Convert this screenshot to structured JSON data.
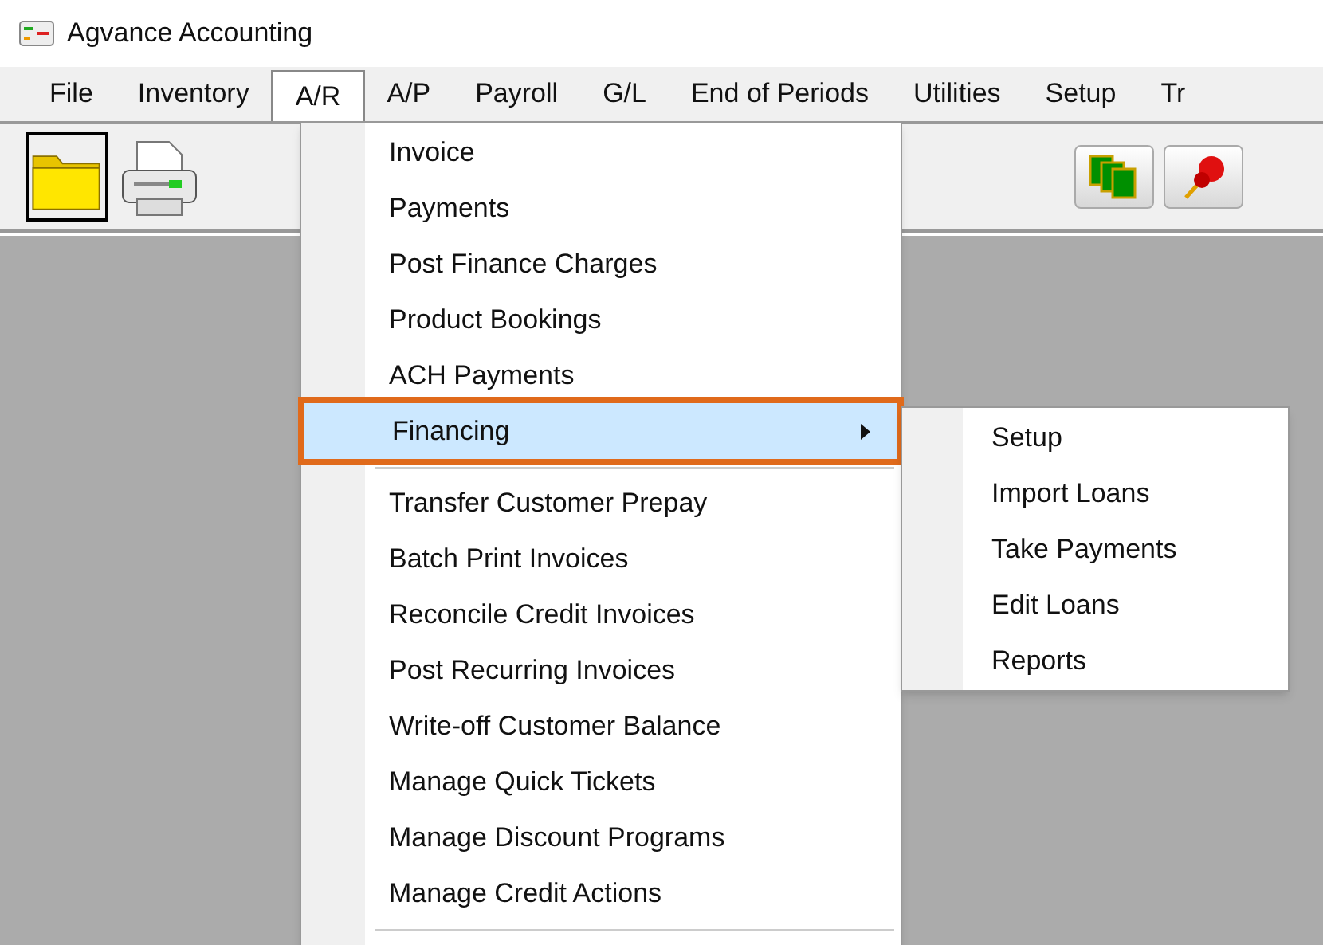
{
  "window": {
    "title": "Agvance Accounting"
  },
  "menu_bar": [
    {
      "label": "File",
      "selected": false
    },
    {
      "label": "Inventory",
      "selected": false
    },
    {
      "label": "A/R",
      "selected": true
    },
    {
      "label": "A/P",
      "selected": false
    },
    {
      "label": "Payroll",
      "selected": false
    },
    {
      "label": "G/L",
      "selected": false
    },
    {
      "label": "End of Periods",
      "selected": false
    },
    {
      "label": "Utilities",
      "selected": false
    },
    {
      "label": "Setup",
      "selected": false
    },
    {
      "label": "Tr",
      "selected": false
    }
  ],
  "dropdown": [
    {
      "kind": "item",
      "label": "Invoice",
      "selected": false,
      "submenu": false
    },
    {
      "kind": "item",
      "label": "Payments",
      "selected": false,
      "submenu": false
    },
    {
      "kind": "item",
      "label": "Post Finance Charges",
      "selected": false,
      "submenu": false
    },
    {
      "kind": "item",
      "label": "Product Bookings",
      "selected": false,
      "submenu": false
    },
    {
      "kind": "item",
      "label": "ACH Payments",
      "selected": false,
      "submenu": false
    },
    {
      "kind": "item",
      "label": "Financing",
      "selected": true,
      "submenu": true
    },
    {
      "kind": "separator"
    },
    {
      "kind": "item",
      "label": "Transfer Customer Prepay",
      "selected": false,
      "submenu": false
    },
    {
      "kind": "item",
      "label": "Batch Print Invoices",
      "selected": false,
      "submenu": false
    },
    {
      "kind": "item",
      "label": "Reconcile Credit Invoices",
      "selected": false,
      "submenu": false
    },
    {
      "kind": "item",
      "label": "Post Recurring Invoices",
      "selected": false,
      "submenu": false
    },
    {
      "kind": "item",
      "label": "Write-off Customer Balance",
      "selected": false,
      "submenu": false
    },
    {
      "kind": "item",
      "label": "Manage Quick Tickets",
      "selected": false,
      "submenu": false
    },
    {
      "kind": "item",
      "label": "Manage Discount Programs",
      "selected": false,
      "submenu": false
    },
    {
      "kind": "item",
      "label": "Manage Credit Actions",
      "selected": false,
      "submenu": false
    },
    {
      "kind": "separator"
    }
  ],
  "submenu": [
    {
      "label": "Setup"
    },
    {
      "label": "Import Loans"
    },
    {
      "label": "Take Payments"
    },
    {
      "label": "Edit Loans"
    },
    {
      "label": "Reports"
    }
  ]
}
